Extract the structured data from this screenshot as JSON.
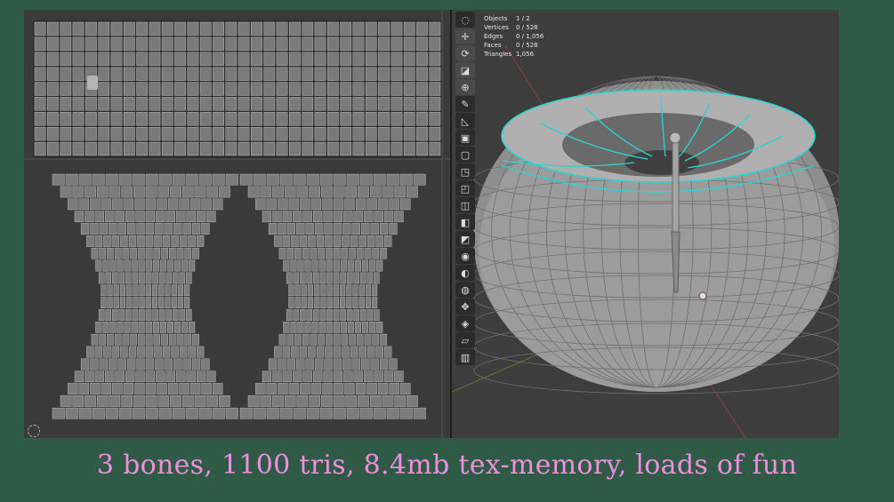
{
  "stats": [
    {
      "label": "Objects",
      "value": "1 / 2"
    },
    {
      "label": "Vertices",
      "value": "0 / 528"
    },
    {
      "label": "Edges",
      "value": "0 / 1,056"
    },
    {
      "label": "Faces",
      "value": "0 / 528"
    },
    {
      "label": "Triangles",
      "value": "1,056"
    }
  ],
  "toolbar": [
    {
      "icon": "select-box-icon"
    },
    {
      "icon": "cursor-icon"
    },
    {
      "icon": "move-icon"
    },
    {
      "icon": "rotate-icon"
    },
    {
      "icon": "scale-icon"
    },
    {
      "icon": "transform-icon"
    },
    {
      "icon": "annotate-icon"
    },
    {
      "icon": "measure-icon"
    },
    {
      "icon": "add-cube-icon"
    },
    {
      "icon": "extrude-icon"
    },
    {
      "icon": "inset-icon"
    },
    {
      "icon": "bevel-icon"
    },
    {
      "icon": "loop-cut-icon"
    },
    {
      "icon": "knife-icon"
    },
    {
      "icon": "poly-build-icon"
    },
    {
      "icon": "spin-icon"
    },
    {
      "icon": "smooth-icon"
    },
    {
      "icon": "edge-slide-icon"
    },
    {
      "icon": "shrink-fatten-icon"
    },
    {
      "icon": "shear-icon"
    },
    {
      "icon": "rip-region-icon"
    }
  ],
  "caption": "3 bones,  1100 tris,  8.4mb tex-memory, loads of fun",
  "colors": {
    "background": "#2f5a45",
    "caption": "#f08ee0",
    "seam": "#28d4d4",
    "mesh": "#9a9a9a"
  }
}
